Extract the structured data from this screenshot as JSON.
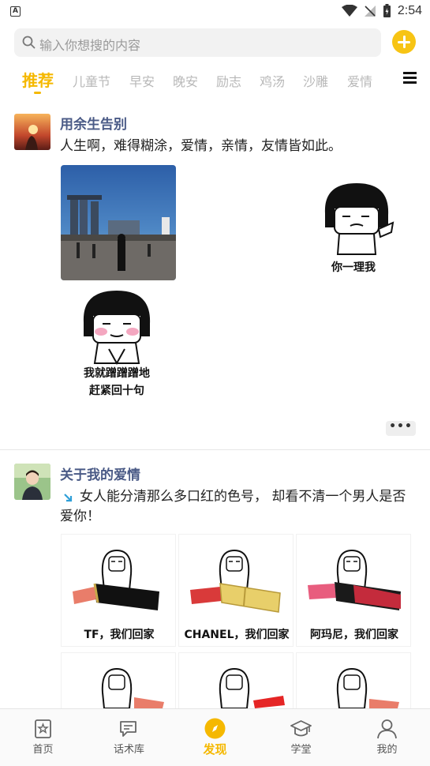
{
  "status_bar": {
    "time": "2:54",
    "app_icon_letter": "A"
  },
  "search": {
    "placeholder": "输入你想搜的内容"
  },
  "tabs": [
    {
      "label": "推荐",
      "active": true
    },
    {
      "label": "儿童节"
    },
    {
      "label": "早安"
    },
    {
      "label": "晚安"
    },
    {
      "label": "励志"
    },
    {
      "label": "鸡汤"
    },
    {
      "label": "沙雕"
    },
    {
      "label": "爱情"
    }
  ],
  "posts": [
    {
      "username": "用余生告别",
      "text": "人生啊，难得糊涂，爱情，亲情，友情皆如此。",
      "memes": [
        {
          "caption": "你一理我"
        },
        {
          "caption_line1": "我就蹭蹭蹭地",
          "caption_line2": "赶紧回十句"
        }
      ],
      "more_label": "•••"
    },
    {
      "username": "关于我的爱情",
      "text": "女人能分清那么多口红的色号， 却看不清一个男人是否爱你！",
      "grid": [
        {
          "caption": "TF，我们回家",
          "lipstick_color": "#e97d6a",
          "case_color": "#111111"
        },
        {
          "caption": "CHANEL，我们回家",
          "lipstick_color": "#d93a3a",
          "case_color": "#e8cf6a"
        },
        {
          "caption": "阿玛尼，我们回家",
          "lipstick_color": "#e85d7e",
          "case_color": "#1a1a1a"
        }
      ]
    }
  ],
  "bottom_nav": [
    {
      "label": "首页",
      "icon": "star-page-icon"
    },
    {
      "label": "话术库",
      "icon": "chat-icon"
    },
    {
      "label": "发现",
      "icon": "compass-icon",
      "active": true
    },
    {
      "label": "学堂",
      "icon": "graduation-cap-icon"
    },
    {
      "label": "我的",
      "icon": "user-icon"
    }
  ],
  "colors": {
    "accent": "#f5b800",
    "username": "#4a5a86"
  }
}
